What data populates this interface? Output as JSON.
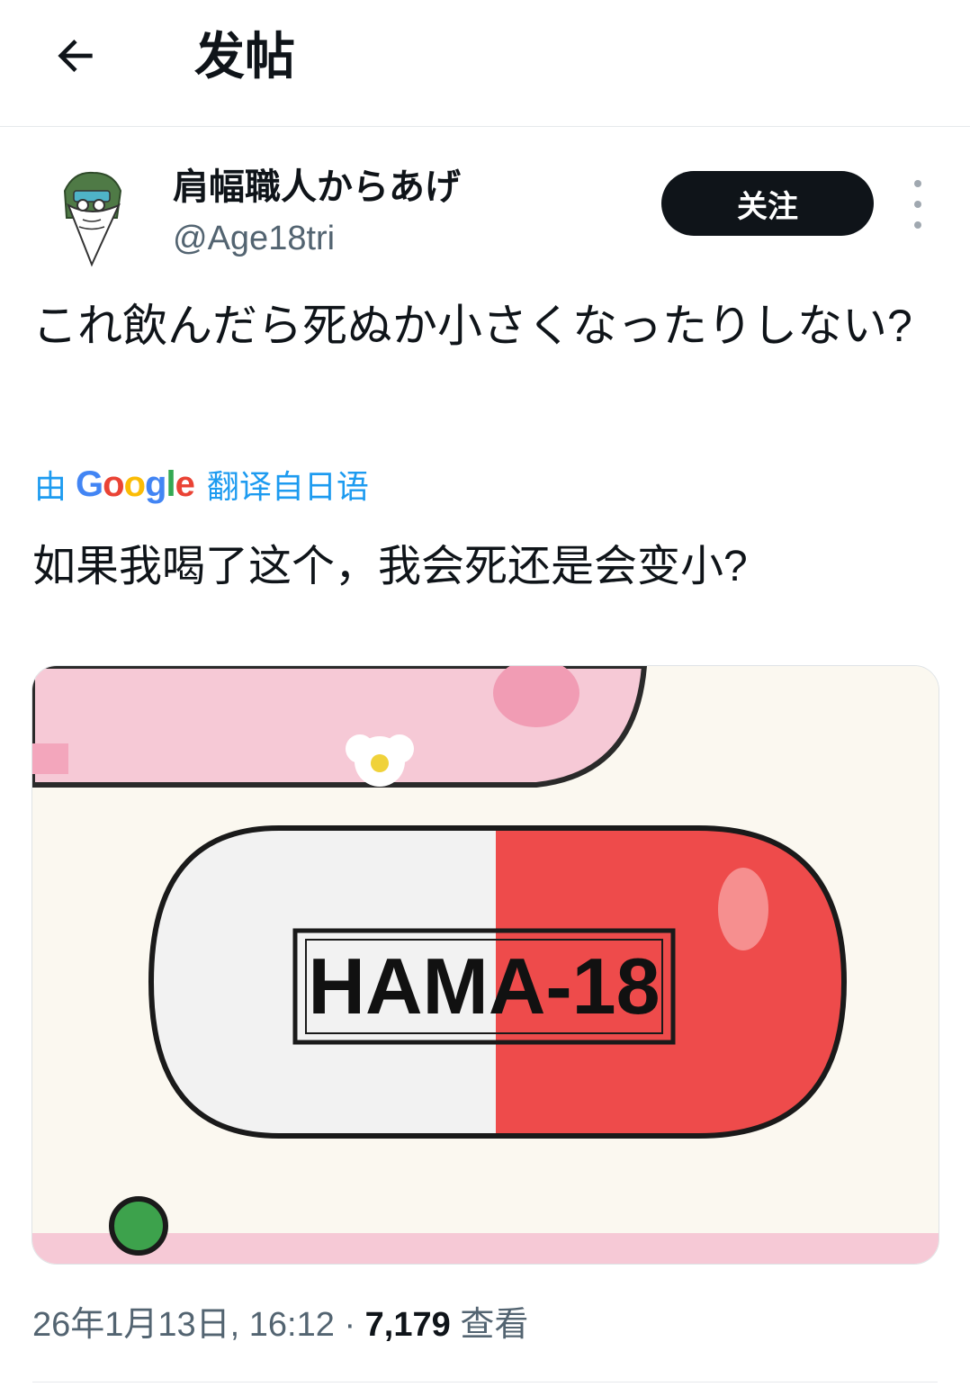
{
  "header": {
    "title": "发帖"
  },
  "author": {
    "display_name": "肩幅職人からあげ",
    "handle": "@Age18tri"
  },
  "follow_button": {
    "label": "关注"
  },
  "post": {
    "text": "これ飲んだら死ぬか小さくなったりしない?",
    "translation": {
      "by_label": "由",
      "provider": "Google",
      "from_label": "翻译自日语",
      "text": "如果我喝了这个，我会死还是会变小?"
    },
    "media": {
      "pill_label": "HAMA-18"
    },
    "timestamp": "26年1月13日, 16:12",
    "separator": "·",
    "views_count": "7,179",
    "views_label": "查看"
  },
  "colors": {
    "link": "#1d9bf0",
    "secondary_text": "#536471",
    "follow_bg": "#0f1419"
  },
  "icons": {
    "back": "arrow-left-icon",
    "more": "more-vertical-icon"
  }
}
